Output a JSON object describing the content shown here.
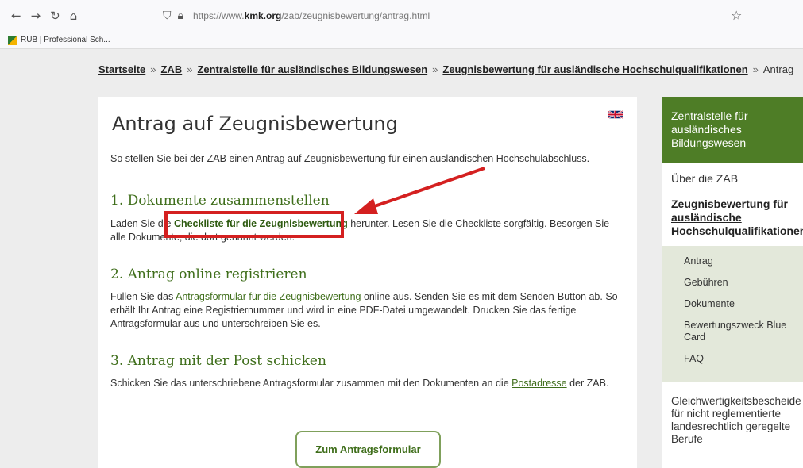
{
  "browser": {
    "nav_icons": [
      "←",
      "→",
      "↻",
      "⌂"
    ],
    "url_prefix": "https://www.",
    "url_domain": "kmk.org",
    "url_path": "/zab/zeugnisbewertung/antrag.html",
    "bookmark": "RUB | Professional Sch..."
  },
  "breadcrumb": {
    "items": [
      "Startseite",
      "ZAB",
      "Zentralstelle für ausländisches Bildungswesen",
      "Zeugnisbewertung für ausländische Hochschulqualifikationen"
    ],
    "current": "Antrag",
    "separator": "»"
  },
  "main": {
    "title": "Antrag auf Zeugnisbewertung",
    "intro": "So stellen Sie bei der ZAB einen Antrag auf Zeugnisbewertung für einen ausländischen Hochschulabschluss.",
    "section1_heading": "1. Dokumente zusammenstellen",
    "section1_pre": "Laden Sie die",
    "section1_link": "Checkliste für die Zeugnisbewertung",
    "section1_post": "herunter. Lesen Sie die Checkliste sorgfältig. Besorgen Sie alle Dokumente, die dort genannt werden.",
    "section2_heading": "2. Antrag online registrieren",
    "section2_pre": "Füllen Sie das",
    "section2_link": "Antragsformular für die Zeugnisbewertung",
    "section2_post": "online aus. Senden Sie es mit dem Senden-Button ab. So erhält Ihr Antrag eine Registriernummer und wird in eine PDF-Datei umgewandelt. Drucken Sie das fertige Antragsformular aus und unterschreiben Sie es.",
    "section3_heading": "3. Antrag mit der Post schicken",
    "section3_pre": "Schicken Sie das unterschriebene Antragsformular zusammen mit den Dokumenten an die",
    "section3_link": "Postadresse",
    "section3_post": "der ZAB.",
    "cta_label": "Zum Antragsformular"
  },
  "sidebar": {
    "header": "Zentralstelle für ausländisches Bildungswesen",
    "about": "Über die ZAB",
    "active_section": "Zeugnisbewertung für ausländische Hochschulqualifikationen",
    "subnav": [
      "Antrag",
      "Gebühren",
      "Dokumente",
      "Bewertungszweck Blue Card",
      "FAQ"
    ],
    "bottom": "Gleichwertigkeitsbescheide für nicht reglementierte landesrechtlich geregelte Berufe"
  },
  "colors": {
    "brand_green": "#4e7d26",
    "link_green": "#3f6e1b",
    "highlight_red": "#d42020"
  }
}
